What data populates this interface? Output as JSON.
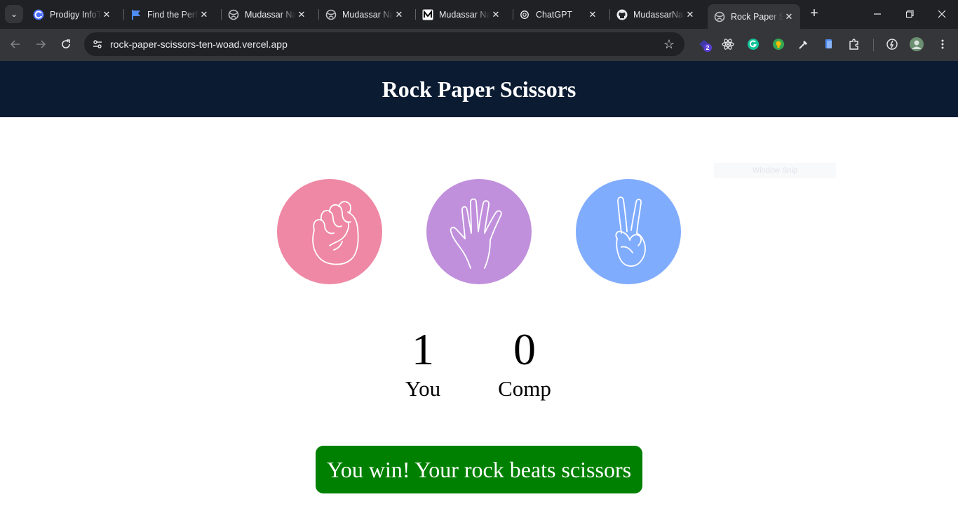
{
  "browser": {
    "tabs": [
      {
        "title": "Prodigy InfoTech",
        "icon": "prodigy-icon"
      },
      {
        "title": "Find the Perfect",
        "icon": "flag-icon"
      },
      {
        "title": "Mudassar Nazir",
        "icon": "globe-icon"
      },
      {
        "title": "Mudassar Nazir",
        "icon": "globe-icon"
      },
      {
        "title": "Mudassar Nazir",
        "icon": "medium-icon"
      },
      {
        "title": "ChatGPT",
        "icon": "chatgpt-icon"
      },
      {
        "title": "MudassarNazir",
        "icon": "github-icon"
      },
      {
        "title": "Rock Paper Scissors",
        "icon": "globe-icon",
        "active": true
      }
    ],
    "url": "rock-paper-scissors-ten-woad.vercel.app",
    "extension_badge": "2"
  },
  "page": {
    "title": "Rock Paper Scissors",
    "header_bg": "#0a1b32",
    "choices": [
      {
        "name": "rock",
        "icon": "fist-icon",
        "color": "#ee88a4"
      },
      {
        "name": "paper",
        "icon": "open-hand-icon",
        "color": "#c190dc"
      },
      {
        "name": "scissors",
        "icon": "victory-hand-icon",
        "color": "#80acfd"
      }
    ],
    "snap_hint": "Window Snip",
    "score": {
      "user": "1",
      "user_label": "You",
      "comp": "0",
      "comp_label": "Comp"
    },
    "result_message": "You win! Your rock beats scissors",
    "result_color": "#008000"
  }
}
